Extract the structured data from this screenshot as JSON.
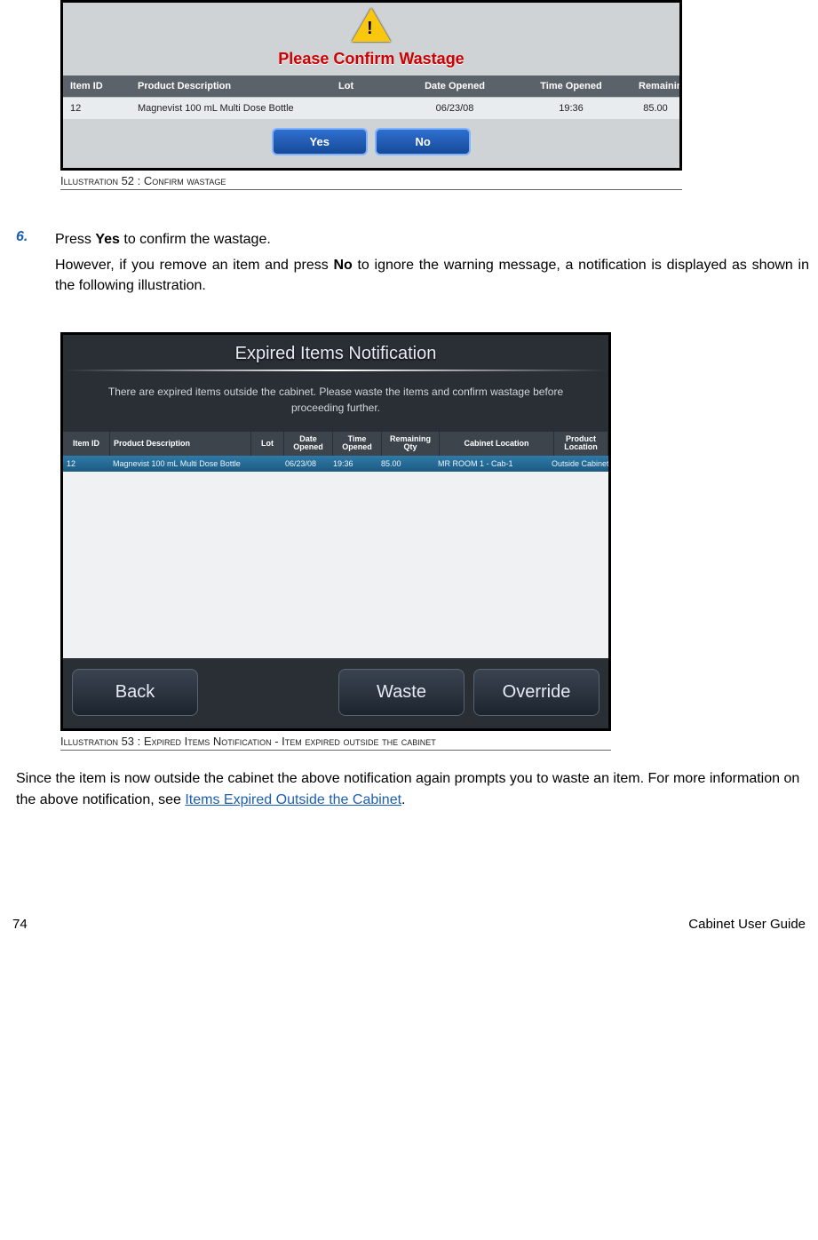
{
  "ill52": {
    "title": "Please Confirm Wastage",
    "headers": {
      "item_id": "Item ID",
      "desc": "Product Description",
      "lot": "Lot",
      "date_opened": "Date Opened",
      "time_opened": "Time Opened",
      "remaining_qty": "Remaining Qty"
    },
    "row": {
      "item_id": "12",
      "desc": "Magnevist 100 mL Multi Dose Bottle",
      "lot": "",
      "date_opened": "06/23/08",
      "time_opened": "19:36",
      "remaining_qty": "85.00"
    },
    "yes": "Yes",
    "no": "No",
    "caption": "Illustration 52 : Confirm wastage"
  },
  "step6": {
    "num": "6.",
    "line1a": "Press ",
    "line1b": "Yes",
    "line1c": " to confirm the wastage.",
    "line2a": "However, if you remove an item and press ",
    "line2b": "No",
    "line2c": " to ignore the warning message, a notification is displayed as shown in the following illustration."
  },
  "ill53": {
    "title": "Expired Items Notification",
    "msg": "There are expired items outside the cabinet. Please waste the items and confirm wastage before proceeding further.",
    "headers": {
      "item_id": "Item ID",
      "desc": "Product Description",
      "lot": "Lot",
      "date_opened": "Date Opened",
      "time_opened": "Time Opened",
      "remaining_qty": "Remaining Qty",
      "cab_loc": "Cabinet Location",
      "prod_loc": "Product Location"
    },
    "row": {
      "item_id": "12",
      "desc": "Magnevist 100 mL Multi Dose Bottle",
      "lot": "",
      "date_opened": "06/23/08",
      "time_opened": "19:36",
      "remaining_qty": "85.00",
      "cab_loc": "MR ROOM 1 - Cab-1",
      "prod_loc": "Outside Cabinet"
    },
    "back": "Back",
    "waste": "Waste",
    "override": "Override",
    "caption": "Illustration 53 : Expired Items Notification - Item expired outside the cabinet"
  },
  "trail": {
    "t1": "Since the item is now outside the cabinet the above notification again prompts you to waste an item. For more information on the above notification, see  ",
    "link": "Items Expired Outside the Cabinet",
    "t2": "."
  },
  "footer": {
    "page": "74",
    "doc": "Cabinet User Guide"
  }
}
